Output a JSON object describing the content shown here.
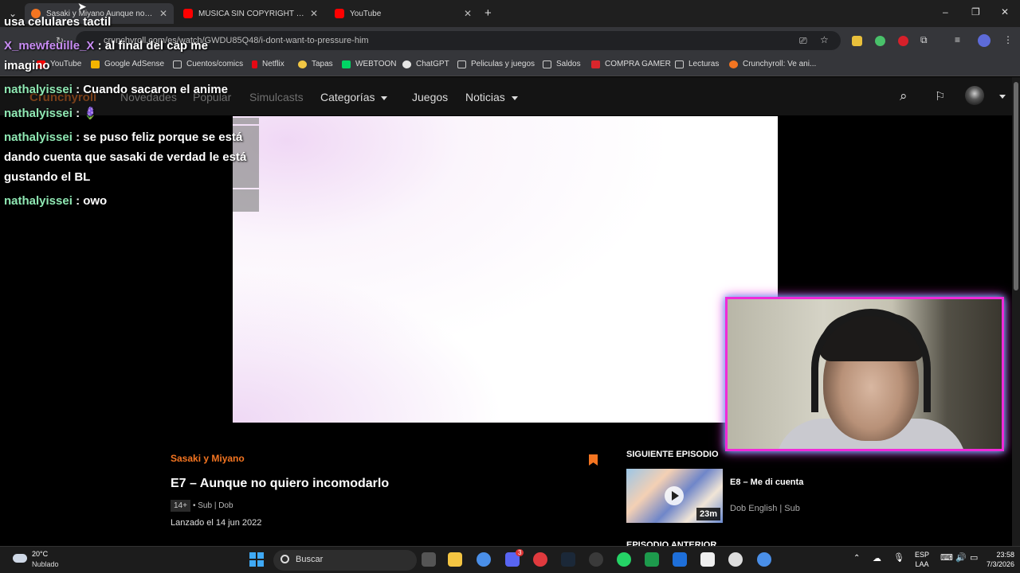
{
  "browser": {
    "tabs": [
      {
        "label": "Sasaki y Miyano Aunque no qu",
        "color": "#f47521",
        "active": true
      },
      {
        "label": "MÚSICA SIN COPYRIGHT PARA",
        "color": "#ff0000",
        "active": false
      },
      {
        "label": "YouTube",
        "color": "#ff0000",
        "active": false
      }
    ],
    "url": "crunchyroll.com/es/watch/GWDU85Q48/i-dont-want-to-pressure-him",
    "bookmarks": [
      "YouTube",
      "Google AdSense",
      "Cuentos/comics",
      "Netflix",
      "Tapas",
      "WEBTOON",
      "ChatGPT",
      "Peliculas y juegos",
      "Saldos",
      "COMPRA GAMER",
      "Lecturas",
      "Crunchyroll: Ve ani..."
    ]
  },
  "site": {
    "logo": "Crunchyroll",
    "nav": [
      "Novedades",
      "Popular",
      "Simulcasts",
      "Categorías",
      "Juegos",
      "Noticias"
    ]
  },
  "chat": [
    {
      "user": "",
      "text": "usa celulares tactil"
    },
    {
      "user": "X_mewfeuille_X",
      "text": ": al final del cap me imagino"
    },
    {
      "user": "nathalyissei",
      "text": ": Cuando sacaron el anime"
    },
    {
      "user": "nathalyissei",
      "text": ": 🪻"
    },
    {
      "user": "nathalyissei",
      "text": ": se puso feliz porque se está dando cuenta que sasaki de verdad le está gustando el BL"
    },
    {
      "user": "nathalyissei",
      "text": ": owo"
    }
  ],
  "episode": {
    "series": "Sasaki y Miyano",
    "title": "E7 – Aunque no quiero incomodarlo",
    "rating": "14+",
    "audio": "• Sub | Dob",
    "released": "Lanzado el 14 jun 2022"
  },
  "next": {
    "heading": "SIGUIENTE EPISODIO",
    "title": "E8 – Me di cuenta",
    "duration": "23m",
    "audio": "Dob English | Sub",
    "prev_heading": "EPISODIO ANTERIOR"
  },
  "taskbar": {
    "temp": "20°C",
    "weather": "Nublado",
    "search": "Buscar",
    "lang": "ESP",
    "lang2": "LAA",
    "time": "23:58",
    "date": "7/3/2026",
    "badge": "3"
  }
}
